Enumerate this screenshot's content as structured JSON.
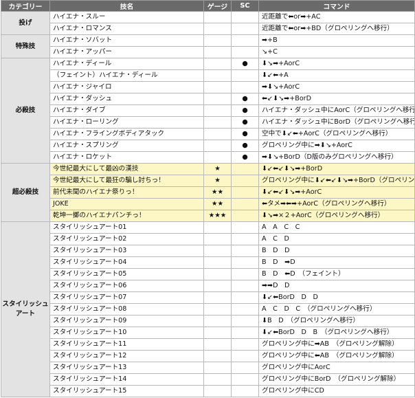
{
  "headers": [
    "カテゴリー",
    "技名",
    "ゲージ",
    "SC",
    "コマンド"
  ],
  "groups": [
    {
      "category": "投げ",
      "highlight": false,
      "rows": [
        {
          "name": "ハイエナ・スルー",
          "gauge": "",
          "sc": "",
          "command": "近距離で⬅or➡+AC"
        },
        {
          "name": "ハイエナ・ロマンス",
          "gauge": "",
          "sc": "",
          "command": "近距離で⬅or➡+BD（グロペリングへ移行）"
        }
      ]
    },
    {
      "category": "特殊技",
      "highlight": false,
      "rows": [
        {
          "name": "ハイエナ・ソバット",
          "gauge": "",
          "sc": "",
          "command": "➡+B"
        },
        {
          "name": "ハイエナ・アッパー",
          "gauge": "",
          "sc": "",
          "command": "↘+C"
        }
      ]
    },
    {
      "category": "必殺技",
      "highlight": false,
      "rows": [
        {
          "name": "ハイエナ・ディール",
          "gauge": "",
          "sc": "●",
          "command": "⬇↘➡+AorC"
        },
        {
          "name": "（フェイント）ハイエナ・ディール",
          "gauge": "",
          "sc": "",
          "command": "⬇↙⬅+A"
        },
        {
          "name": "ハイエナ・ジャイロ",
          "gauge": "",
          "sc": "",
          "command": "➡⬇↘+AorC"
        },
        {
          "name": "ハイエナ・ダッシュ",
          "gauge": "",
          "sc": "●",
          "command": "⬅↙⬇↘➡+BorD"
        },
        {
          "name": "ハイエナ・ダイブ",
          "gauge": "",
          "sc": "●",
          "command": "ハイエナ・ダッシュ中にAorC（グロペリングへ移行）"
        },
        {
          "name": "ハイエナ・ローリング",
          "gauge": "",
          "sc": "●",
          "command": "ハイエナ・ダッシュ中にBorD（グロペリングへ移行）"
        },
        {
          "name": "ハイエナ・フライングボディアタック",
          "gauge": "",
          "sc": "●",
          "command": "空中で⬇↙⬅+AorC（グロペリングへ移行）"
        },
        {
          "name": "ハイエナ・スプリング",
          "gauge": "",
          "sc": "●",
          "command": "グロペリング中に➡⬇↘+AorC"
        },
        {
          "name": "ハイエナ・ロケット",
          "gauge": "",
          "sc": "●",
          "command": "➡⬇↘+BorD（D版のみグロペリングへ移行）"
        }
      ]
    },
    {
      "category": "超必殺技",
      "highlight": true,
      "rows": [
        {
          "name": "今世紀最大にして最凶の漢技",
          "gauge": "★",
          "sc": "",
          "command": "⬇↙⬅↙⬇↘➡+BorD"
        },
        {
          "name": "今世紀最大にして最狂の騙し討ちっ！",
          "gauge": "★",
          "sc": "",
          "command": "グロペリング中に⬇↙⬅↙⬇↘➡+BorD（グロペリング解除）"
        },
        {
          "name": "前代未聞のハイエナ祭りっ！",
          "gauge": "★★",
          "sc": "",
          "command": "⬇↙⬅↙⬇↘➡+AorC"
        },
        {
          "name": "JOKE",
          "gauge": "★★",
          "sc": "",
          "command": "⬅タメ➡⬅➡+AorC（グロペリングへ移行）"
        },
        {
          "name": "乾坤一擲のハイエナパンチっ！",
          "gauge": "★★★",
          "sc": "",
          "command": "⬇↘➡×２+AorC（グロペリングへ移行）"
        }
      ]
    },
    {
      "category": "スタイリッシュアート",
      "highlight": false,
      "rows": [
        {
          "name": "スタイリッシュアート01",
          "gauge": "",
          "sc": "",
          "command": "A　A　C　C"
        },
        {
          "name": "スタイリッシュアート02",
          "gauge": "",
          "sc": "",
          "command": "A　C　D"
        },
        {
          "name": "スタイリッシュアート03",
          "gauge": "",
          "sc": "",
          "command": "B　D　D"
        },
        {
          "name": "スタイリッシュアート04",
          "gauge": "",
          "sc": "",
          "command": "B　D　➡D"
        },
        {
          "name": "スタイリッシュアート05",
          "gauge": "",
          "sc": "",
          "command": "B　D　⬅D　（フェイント）"
        },
        {
          "name": "スタイリッシュアート06",
          "gauge": "",
          "sc": "",
          "command": "➡➡D　D"
        },
        {
          "name": "スタイリッシュアート07",
          "gauge": "",
          "sc": "",
          "command": "⬇↙⬅BorD　D　D"
        },
        {
          "name": "スタイリッシュアート08",
          "gauge": "",
          "sc": "",
          "command": "A　C　D　C　（グロペリングへ移行）"
        },
        {
          "name": "スタイリッシュアート09",
          "gauge": "",
          "sc": "",
          "command": "⬇B　D　（グロペリングへ移行）"
        },
        {
          "name": "スタイリッシュアート10",
          "gauge": "",
          "sc": "",
          "command": "⬇↙⬅BorD　D　B　（グロペリングへ移行）"
        },
        {
          "name": "スタイリッシュアート11",
          "gauge": "",
          "sc": "",
          "command": "グロペリング中に➡AB　（グロペリング解除）"
        },
        {
          "name": "スタイリッシュアート12",
          "gauge": "",
          "sc": "",
          "command": "グロペリング中に⬅AB　（グロペリング解除）"
        },
        {
          "name": "スタイリッシュアート13",
          "gauge": "",
          "sc": "",
          "command": "グロペリング中にAorC"
        },
        {
          "name": "スタイリッシュアート14",
          "gauge": "",
          "sc": "",
          "command": "グロペリング中にBorD　（グロペリング解除）"
        },
        {
          "name": "スタイリッシュアート15",
          "gauge": "",
          "sc": "",
          "command": "グロペリング中にCD"
        }
      ]
    }
  ]
}
